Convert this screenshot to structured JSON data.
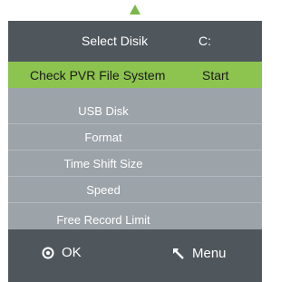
{
  "header": {
    "label": "Select Disik",
    "value": "C:"
  },
  "items": [
    {
      "label": "Check PVR File System",
      "value": "Start",
      "selected": true
    },
    {
      "label": "USB Disk",
      "value": ""
    },
    {
      "label": "Format",
      "value": ""
    },
    {
      "label": "Time Shift Size",
      "value": ""
    },
    {
      "label": "Speed",
      "value": ""
    },
    {
      "label": "Free Record Limit",
      "value": ""
    }
  ],
  "footer": {
    "ok_label": "OK",
    "menu_label": "Menu",
    "ok_icon": "ok-circle-icon",
    "menu_icon": "return-arrow-icon"
  },
  "colors": {
    "panel_dark": "#4f575d",
    "panel_light": "#9ca3a9",
    "highlight": "#8dc34f",
    "up_arrow": "#7ab648"
  }
}
